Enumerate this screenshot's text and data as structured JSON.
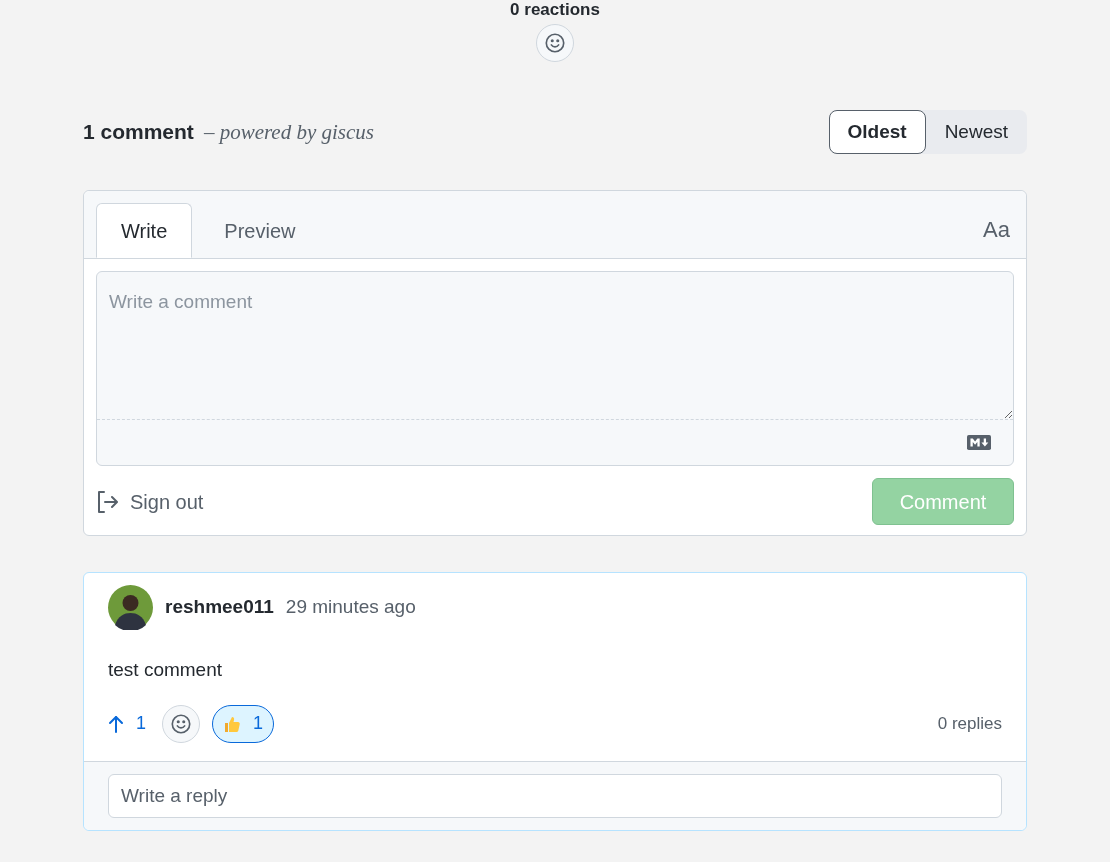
{
  "reactions_header": {
    "label": "0 reactions"
  },
  "comments_header": {
    "count": "1 comment",
    "powered_by": "– powered by giscus"
  },
  "sort": [
    {
      "label": "Oldest",
      "selected": true
    },
    {
      "label": "Newest",
      "selected": false
    }
  ],
  "editor": {
    "tabs": [
      {
        "label": "Write",
        "selected": true
      },
      {
        "label": "Preview",
        "selected": false
      }
    ],
    "format_label": "Aa",
    "placeholder": "Write a comment",
    "sign_out": "Sign out",
    "submit": {
      "label": "Comment",
      "disabled": true
    }
  },
  "comments": [
    {
      "author": "reshmee011",
      "time": "29 minutes ago",
      "body": "test comment",
      "upvotes": "1",
      "upvoted": true,
      "reactions": [
        {
          "count": "1",
          "selected": true
        }
      ],
      "replies": "0 replies",
      "reply_placeholder": "Write a reply"
    }
  ]
}
